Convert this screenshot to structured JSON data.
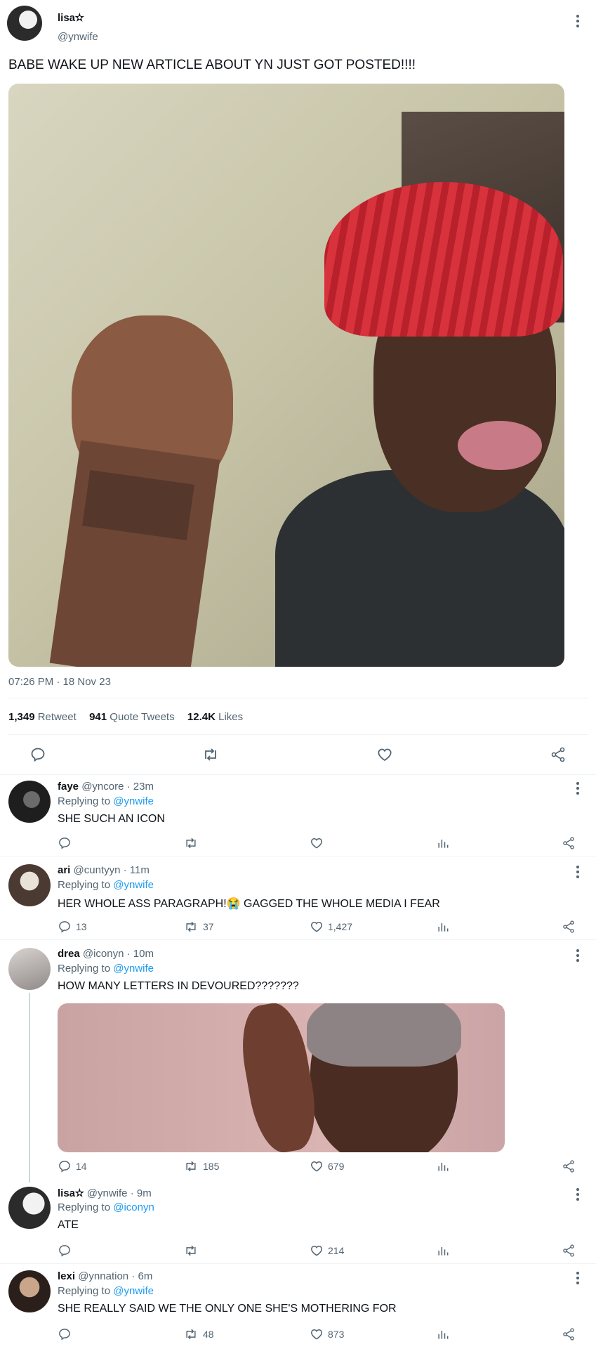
{
  "tweet": {
    "author_name": "lisa✫",
    "author_handle": "@ynwife",
    "text": "BABE WAKE UP NEW ARTICLE ABOUT YN JUST GOT POSTED!!!!",
    "time": "07:26 PM · 18 Nov 23",
    "stats": {
      "retweets_count": "1,349",
      "retweets_label": "Retweet",
      "quotes_count": "941",
      "quotes_label": "Quote Tweets",
      "likes_count": "12.4K",
      "likes_label": "Likes"
    }
  },
  "replies": [
    {
      "name": "faye",
      "handle": "@yncore",
      "time": "23m",
      "replying_label": "Replying to",
      "replying_to": "@ynwife",
      "text": "SHE SUCH AN ICON",
      "comments": "",
      "retweets": "",
      "likes": ""
    },
    {
      "name": "ari",
      "handle": "@cuntyyn",
      "time": "11m",
      "replying_label": "Replying to",
      "replying_to": "@ynwife",
      "text": "HER WHOLE ASS PARAGRAPH!😭 GAGGED THE WHOLE MEDIA I FEAR",
      "comments": "13",
      "retweets": "37",
      "likes": "1,427"
    },
    {
      "name": "drea",
      "handle": "@iconyn",
      "time": "10m",
      "replying_label": "Replying to",
      "replying_to": "@ynwife",
      "text": "HOW MANY LETTERS IN DEVOURED???????",
      "comments": "14",
      "retweets": "185",
      "likes": "679"
    },
    {
      "name": "lisa✫",
      "handle": "@ynwife",
      "time": "9m",
      "replying_label": "Replying to",
      "replying_to": "@iconyn",
      "text": "ATE",
      "comments": "",
      "retweets": "",
      "likes": "214"
    },
    {
      "name": "lexi",
      "handle": "@ynnation",
      "time": "6m",
      "replying_label": "Replying to",
      "replying_to": "@ynwife",
      "text": "SHE REALLY SAID WE THE ONLY ONE SHE'S MOTHERING FOR",
      "comments": "",
      "retweets": "48",
      "likes": "873"
    }
  ],
  "colors": {
    "accent": "#1d9bf0",
    "text": "#0f1419",
    "secondary": "#536471",
    "divider": "#eff3f4"
  }
}
